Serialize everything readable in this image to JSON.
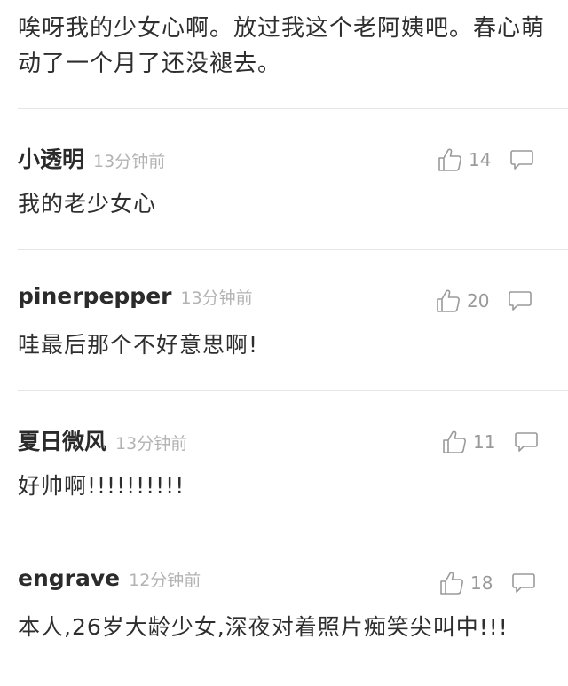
{
  "top_comment_text": "唉呀我的少女心啊。放过我这个老阿姨吧。春心萌动了一个月了还没褪去。",
  "comments": [
    {
      "username": "小透明",
      "time": "13分钟前",
      "likes": "14",
      "text": "我的老少女心"
    },
    {
      "username": "pinerpepper",
      "time": "13分钟前",
      "likes": "20",
      "text": "哇最后那个不好意思啊!"
    },
    {
      "username": "夏日微风",
      "time": "13分钟前",
      "likes": "11",
      "text": "好帅啊!!!!!!!!!!"
    },
    {
      "username": "engrave",
      "time": "12分钟前",
      "likes": "18",
      "text": "本人,26岁大龄少女,深夜对着照片痴笑尖叫中!!!"
    }
  ],
  "icons": {
    "like": "thumbs-up-icon",
    "reply": "comment-bubble-icon"
  },
  "colors": {
    "text": "#2e2e2e",
    "muted": "#b3b3b3",
    "count": "#9a9a9a",
    "divider": "#e6e6e6"
  }
}
